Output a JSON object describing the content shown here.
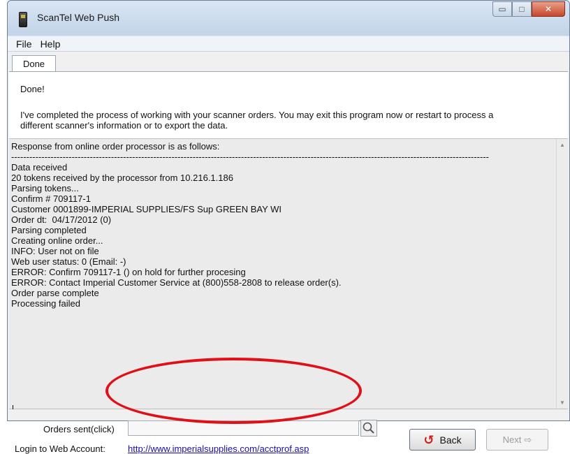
{
  "window": {
    "title": "ScanTel Web Push",
    "controls": {
      "minimize": "▭",
      "maximize": "□",
      "close": "✕"
    }
  },
  "menu": {
    "items": [
      "File",
      "Help"
    ]
  },
  "tab": {
    "label": "Done"
  },
  "content": {
    "heading": "Done!",
    "intro": "I've completed the process of working with your scanner orders. You may exit this program now or restart to process a different scanner's information or to export the data."
  },
  "log": {
    "lines": [
      "Response from online order processor is as follows:",
      "--------------------------------------------------------------------------------------------------------------------------------------------------------------",
      "Data received",
      "20 tokens received by the processor from 10.216.1.186",
      "Parsing tokens...",
      "Confirm # 709117-1",
      "Customer 0001899-IMPERIAL SUPPLIES/FS Sup GREEN BAY WI",
      "Order dt:  04/17/2012 (0)",
      "Parsing completed",
      "Creating online order...",
      "INFO: User not on file",
      "Web user status: 0 (Email: -)",
      "ERROR: Confirm 709117-1 () on hold for further procesing",
      "ERROR: Contact Imperial Customer Service at (800)558-2808 to release order(s).",
      "Order parse complete",
      "Processing failed"
    ]
  },
  "bottom": {
    "orders_label": "Orders sent(click)",
    "orders_value": "",
    "login_label": "Login to Web Account:",
    "login_url": "http://www.imperialsupplies.com/acctprof.asp",
    "back_label": "Back",
    "next_label": "Next",
    "back_icon": "↺",
    "next_icon": "⇨"
  },
  "colors": {
    "highlight": "#e01018",
    "link": "#1a0dab",
    "back_arrow": "#d41b1b"
  }
}
